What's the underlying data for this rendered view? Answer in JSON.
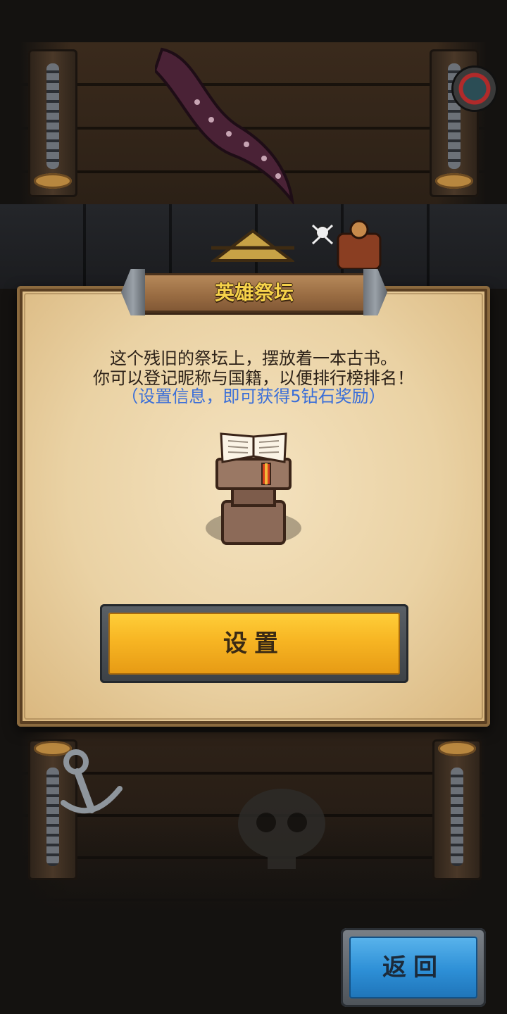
{
  "dialog": {
    "title": "英雄祭坛",
    "line1": "这个残旧的祭坛上，摆放着一本古书。",
    "line2": "你可以登记昵称与国籍，以便排行榜排名！",
    "line3": "（设置信息，即可获得5钻石奖励）"
  },
  "buttons": {
    "set_label": "设置",
    "back_label": "返回"
  },
  "colors": {
    "title_gold": "#f6d24a",
    "reward_blue": "#3a6ed8",
    "set_button": "#f7b523",
    "back_button": "#2d8fd6"
  },
  "icons": {
    "altar": "altar-book-icon",
    "menu": "menu-badge-icon"
  }
}
